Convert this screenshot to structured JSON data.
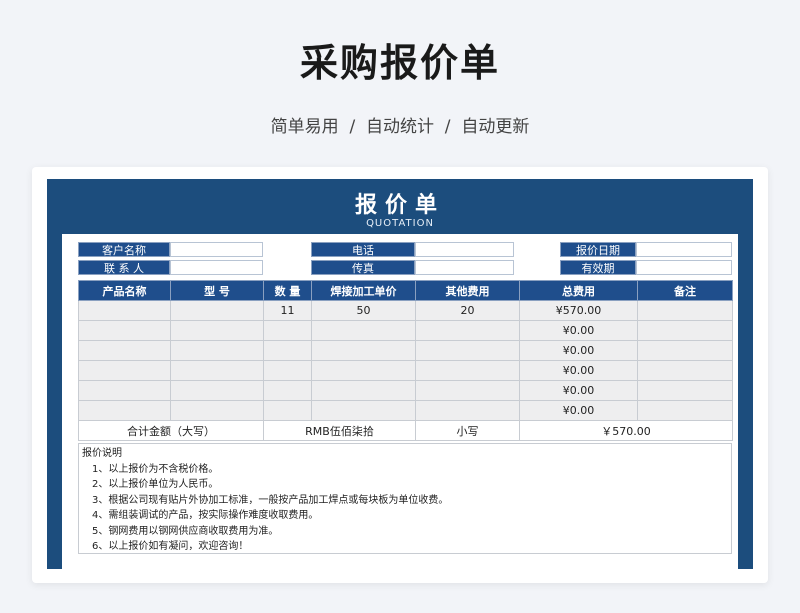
{
  "hero": {
    "title": "采购报价单",
    "subtitle": "简单易用  /  自动统计  /  自动更新"
  },
  "sheet": {
    "title": "报价单",
    "subtitle": "QUOTATION"
  },
  "info": {
    "customer_label": "客户名称",
    "contact_label": "联 系 人",
    "phone_label": "电话",
    "fax_label": "传真",
    "date_label": "报价日期",
    "validity_label": "有效期",
    "customer_value": "",
    "contact_value": "",
    "phone_value": "",
    "fax_value": "",
    "date_value": "",
    "validity_value": ""
  },
  "table": {
    "headers": [
      "产品名称",
      "型 号",
      "数 量",
      "焊接加工单价",
      "其他费用",
      "总费用",
      "备注"
    ],
    "rows": [
      [
        "",
        "",
        "11",
        "50",
        "20",
        "¥570.00",
        ""
      ],
      [
        "",
        "",
        "",
        "",
        "",
        "¥0.00",
        ""
      ],
      [
        "",
        "",
        "",
        "",
        "",
        "¥0.00",
        ""
      ],
      [
        "",
        "",
        "",
        "",
        "",
        "¥0.00",
        ""
      ],
      [
        "",
        "",
        "",
        "",
        "",
        "¥0.00",
        ""
      ],
      [
        "",
        "",
        "",
        "",
        "",
        "¥0.00",
        ""
      ]
    ],
    "total_label": "合计金额（大写）",
    "total_words": "RMB伍佰柒拾",
    "small_label": "小写",
    "total_numeric": "￥570.00"
  },
  "notes": {
    "heading": "报价说明",
    "lines": [
      "1、以上报价为不含税价格。",
      "2、以上报价单位为人民币。",
      "3、根据公司现有贴片外协加工标准，一般按产品加工焊点或每块板为单位收费。",
      "4、需组装调试的产品，按实际操作难度收取费用。",
      "5、钢网费用以钢网供应商收取费用为准。",
      "6、以上报价如有凝问，欢迎咨询！"
    ]
  },
  "colors": {
    "sheet_bg": "#1c4d7d",
    "header_bg": "#1f4e8c",
    "accent_red": "#b0191b"
  }
}
